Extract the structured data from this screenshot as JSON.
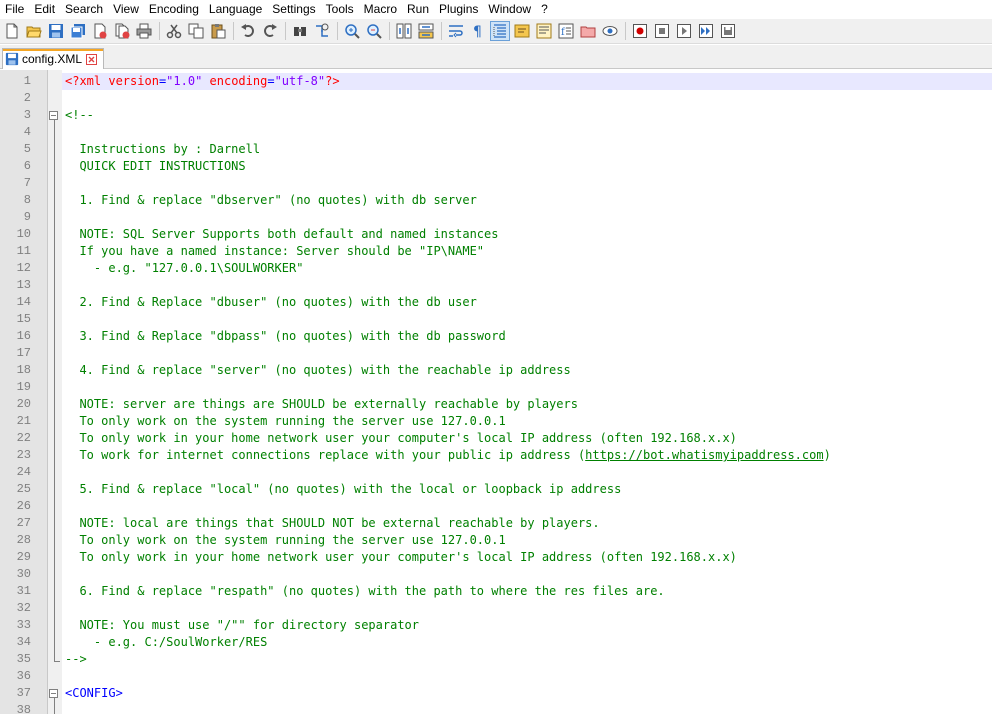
{
  "menu": [
    "File",
    "Edit",
    "Search",
    "View",
    "Encoding",
    "Language",
    "Settings",
    "Tools",
    "Macro",
    "Run",
    "Plugins",
    "Window",
    "?"
  ],
  "toolbar": {
    "icons": [
      "new-file-icon",
      "open-file-icon",
      "save-icon",
      "save-all-icon",
      "close-icon",
      "close-all-icon",
      "print-icon",
      "cut-icon",
      "copy-icon",
      "paste-icon",
      "undo-icon",
      "redo-icon",
      "find-icon",
      "replace-icon",
      "zoom-in-icon",
      "zoom-out-icon",
      "sync-vertical-icon",
      "sync-horizontal-icon",
      "word-wrap-icon",
      "show-all-characters-icon",
      "indent-guide-icon",
      "user-defined-language-icon",
      "document-map-icon",
      "function-list-icon",
      "folder-as-workspace-icon",
      "monitoring-icon",
      "record-macro-icon",
      "stop-recording-icon",
      "play-macro-icon",
      "run-macro-multiple-icon",
      "save-macro-icon"
    ]
  },
  "tab": {
    "filename": "config.XML"
  },
  "editor": {
    "lines": [
      {
        "n": "1",
        "segments": [
          {
            "t": "<?xml ",
            "c": "c-pi"
          },
          {
            "t": "version",
            "c": "c-red"
          },
          {
            "t": "=",
            "c": "c-tag"
          },
          {
            "t": "\"1.0\"",
            "c": "c-str"
          },
          {
            "t": " ",
            "c": "c-pi"
          },
          {
            "t": "encoding",
            "c": "c-red"
          },
          {
            "t": "=",
            "c": "c-tag"
          },
          {
            "t": "\"utf-8\"",
            "c": "c-str"
          },
          {
            "t": "?>",
            "c": "c-pi"
          }
        ]
      },
      {
        "n": "2",
        "segments": []
      },
      {
        "n": "3",
        "segments": [
          {
            "t": "<!--",
            "c": ""
          }
        ]
      },
      {
        "n": "4",
        "segments": []
      },
      {
        "n": "5",
        "segments": [
          {
            "t": "  Instructions by : Darnell",
            "c": ""
          }
        ]
      },
      {
        "n": "6",
        "segments": [
          {
            "t": "  QUICK EDIT INSTRUCTIONS",
            "c": ""
          }
        ]
      },
      {
        "n": "7",
        "segments": []
      },
      {
        "n": "8",
        "segments": [
          {
            "t": "  1. Find & replace \"dbserver\" (no quotes) with db server",
            "c": ""
          }
        ]
      },
      {
        "n": "9",
        "segments": []
      },
      {
        "n": "10",
        "segments": [
          {
            "t": "  NOTE: SQL Server Supports both default and named instances",
            "c": ""
          }
        ]
      },
      {
        "n": "11",
        "segments": [
          {
            "t": "  If you have a named instance: Server should be \"IP\\NAME\"",
            "c": ""
          }
        ]
      },
      {
        "n": "12",
        "segments": [
          {
            "t": "    - e.g. \"127.0.0.1\\SOULWORKER\"",
            "c": ""
          }
        ]
      },
      {
        "n": "13",
        "segments": []
      },
      {
        "n": "14",
        "segments": [
          {
            "t": "  2. Find & Replace \"dbuser\" (no quotes) with the db user",
            "c": ""
          }
        ]
      },
      {
        "n": "15",
        "segments": []
      },
      {
        "n": "16",
        "segments": [
          {
            "t": "  3. Find & Replace \"dbpass\" (no quotes) with the db password",
            "c": ""
          }
        ]
      },
      {
        "n": "17",
        "segments": []
      },
      {
        "n": "18",
        "segments": [
          {
            "t": "  4. Find & replace \"server\" (no quotes) with the reachable ip address",
            "c": ""
          }
        ]
      },
      {
        "n": "19",
        "segments": []
      },
      {
        "n": "20",
        "segments": [
          {
            "t": "  NOTE: server are things are SHOULD be externally reachable by players",
            "c": ""
          }
        ]
      },
      {
        "n": "21",
        "segments": [
          {
            "t": "  To only work on the system running the server use 127.0.0.1",
            "c": ""
          }
        ]
      },
      {
        "n": "22",
        "segments": [
          {
            "t": "  To only work in your home network user your computer's local IP address (often 192.168.x.x)",
            "c": ""
          }
        ]
      },
      {
        "n": "23",
        "segments": [
          {
            "t": "  To work for internet connections replace with your public ip address (",
            "c": ""
          },
          {
            "t": "https://bot.whatismyipaddress.com",
            "c": "link"
          },
          {
            "t": ")",
            "c": ""
          }
        ]
      },
      {
        "n": "24",
        "segments": []
      },
      {
        "n": "25",
        "segments": [
          {
            "t": "  5. Find & replace \"local\" (no quotes) with the local or loopback ip address",
            "c": ""
          }
        ]
      },
      {
        "n": "26",
        "segments": []
      },
      {
        "n": "27",
        "segments": [
          {
            "t": "  NOTE: local are things that SHOULD NOT be external reachable by players.",
            "c": ""
          }
        ]
      },
      {
        "n": "28",
        "segments": [
          {
            "t": "  To only work on the system running the server use 127.0.0.1",
            "c": ""
          }
        ]
      },
      {
        "n": "29",
        "segments": [
          {
            "t": "  To only work in your home network user your computer's local IP address (often 192.168.x.x)",
            "c": ""
          }
        ]
      },
      {
        "n": "30",
        "segments": []
      },
      {
        "n": "31",
        "segments": [
          {
            "t": "  6. Find & replace \"respath\" (no quotes) with the path to where the res files are.",
            "c": ""
          }
        ]
      },
      {
        "n": "32",
        "segments": []
      },
      {
        "n": "33",
        "segments": [
          {
            "t": "  NOTE: You must use \"/\"\" for directory separator",
            "c": ""
          }
        ]
      },
      {
        "n": "34",
        "segments": [
          {
            "t": "    - e.g. C:/SoulWorker/RES",
            "c": ""
          }
        ]
      },
      {
        "n": "35",
        "segments": [
          {
            "t": "-->",
            "c": ""
          }
        ]
      },
      {
        "n": "36",
        "segments": []
      },
      {
        "n": "37",
        "segments": [
          {
            "t": "<CONFIG>",
            "c": "c-tag"
          }
        ]
      },
      {
        "n": "38",
        "segments": []
      }
    ]
  }
}
